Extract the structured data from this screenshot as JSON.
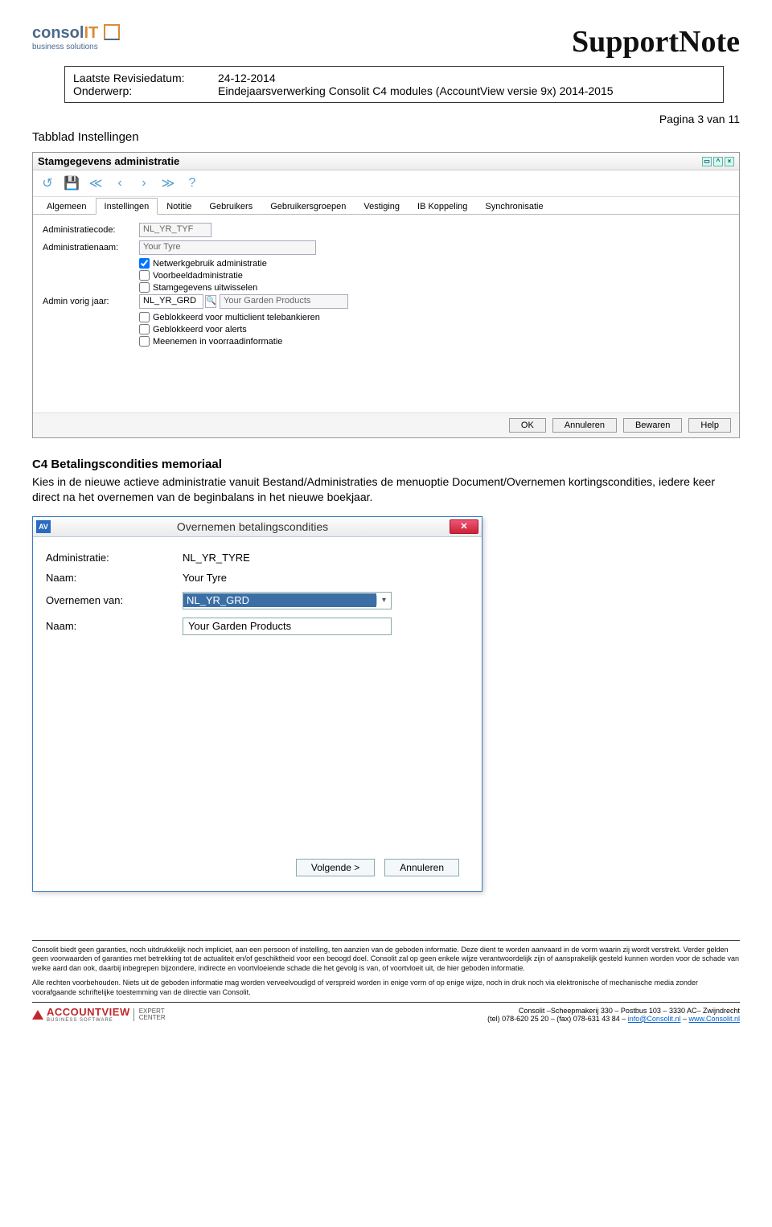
{
  "header": {
    "logo_main1": "consol",
    "logo_main2": "IT",
    "logo_sub": "business solutions",
    "title": "SupportNote"
  },
  "meta": {
    "label_revision": "Laatste Revisiedatum:",
    "value_revision": "24-12-2014",
    "label_subject": "Onderwerp:",
    "value_subject": "Eindejaarsverwerking Consolit C4 modules (AccountView versie 9x) 2014-2015"
  },
  "page_number": "Pagina 3 van 11",
  "section1_title": "Tabblad Instellingen",
  "shot1": {
    "window_title": "Stamgegevens administratie",
    "tabs": [
      "Algemeen",
      "Instellingen",
      "Notitie",
      "Gebruikers",
      "Gebruikersgroepen",
      "Vestiging",
      "IB Koppeling",
      "Synchronisatie"
    ],
    "active_tab": 1,
    "fields": {
      "admincode_label": "Administratiecode:",
      "admincode_value": "NL_YR_TYF",
      "adminnaam_label": "Administratienaam:",
      "adminnaam_value": "Your Tyre",
      "chk_netwerk": "Netwerkgebruik administratie",
      "chk_voorbeeld": "Voorbeeldadministratie",
      "chk_stam": "Stamgegevens uitwisselen",
      "vorigjaar_label": "Admin vorig jaar:",
      "vorigjaar_code": "NL_YR_GRD",
      "vorigjaar_name": "Your Garden Products",
      "chk_multi": "Geblokkeerd voor multiclient telebankieren",
      "chk_alerts": "Geblokkeerd voor alerts",
      "chk_voorraad": "Meenemen in voorraadinformatie"
    },
    "buttons": {
      "ok": "OK",
      "cancel": "Annuleren",
      "save": "Bewaren",
      "help": "Help"
    }
  },
  "body": {
    "heading": "C4 Betalingscondities memoriaal",
    "paragraph": "Kies in de nieuwe actieve administratie vanuit Bestand/Administraties de menuoptie Document/Overnemen kortingscondities, iedere keer direct na het overnemen van de beginbalans in het nieuwe boekjaar."
  },
  "shot2": {
    "title": "Overnemen betalingscondities",
    "admin_label": "Administratie:",
    "admin_value": "NL_YR_TYRE",
    "naam1_label": "Naam:",
    "naam1_value": "Your Tyre",
    "overnemen_label": "Overnemen van:",
    "overnemen_value": "NL_YR_GRD",
    "naam2_label": "Naam:",
    "naam2_value": "Your Garden Products",
    "btn_next": "Volgende >",
    "btn_cancel": "Annuleren"
  },
  "disclaimer": {
    "p1": "Consolit biedt geen garanties, noch uitdrukkelijk noch impliciet, aan een persoon of instelling, ten aanzien van de geboden informatie. Deze dient te worden aanvaard in de vorm waarin zij wordt verstrekt. Verder gelden geen voorwaarden of garanties met betrekking tot de actualiteit en/of geschiktheid voor een beoogd doel. Consolit zal op geen enkele wijze verantwoordelijk zijn of aansprakelijk gesteld kunnen worden voor de schade van welke aard dan ook, daarbij inbegrepen bijzondere, indirecte en voortvloeiende schade die het gevolg is van, of voortvloeit uit, de hier geboden informatie.",
    "p2": "Alle rechten voorbehouden. Niets uit de geboden informatie mag worden verveelvoudigd of verspreid worden in enige vorm of op enige wijze, noch in druk noch via elektronische of mechanische media zonder voorafgaande schriftelijke toestemming van de directie van Consolit."
  },
  "footer": {
    "av_logo": "ACCOUNTVIEW",
    "av_sub": "BUSINESS SOFTWARE",
    "expert1": "EXPERT",
    "expert2": "CENTER",
    "addr": "Consolit –Scheepmakerij 330 – Postbus 103 – 3330 AC– Zwijndrecht",
    "tel": "(tel) 078-620 25 20 – (fax) 078-631 43 84 – ",
    "email": "info@Consolit.nl",
    "sep": " – ",
    "web": "www.Consolit.nl"
  }
}
